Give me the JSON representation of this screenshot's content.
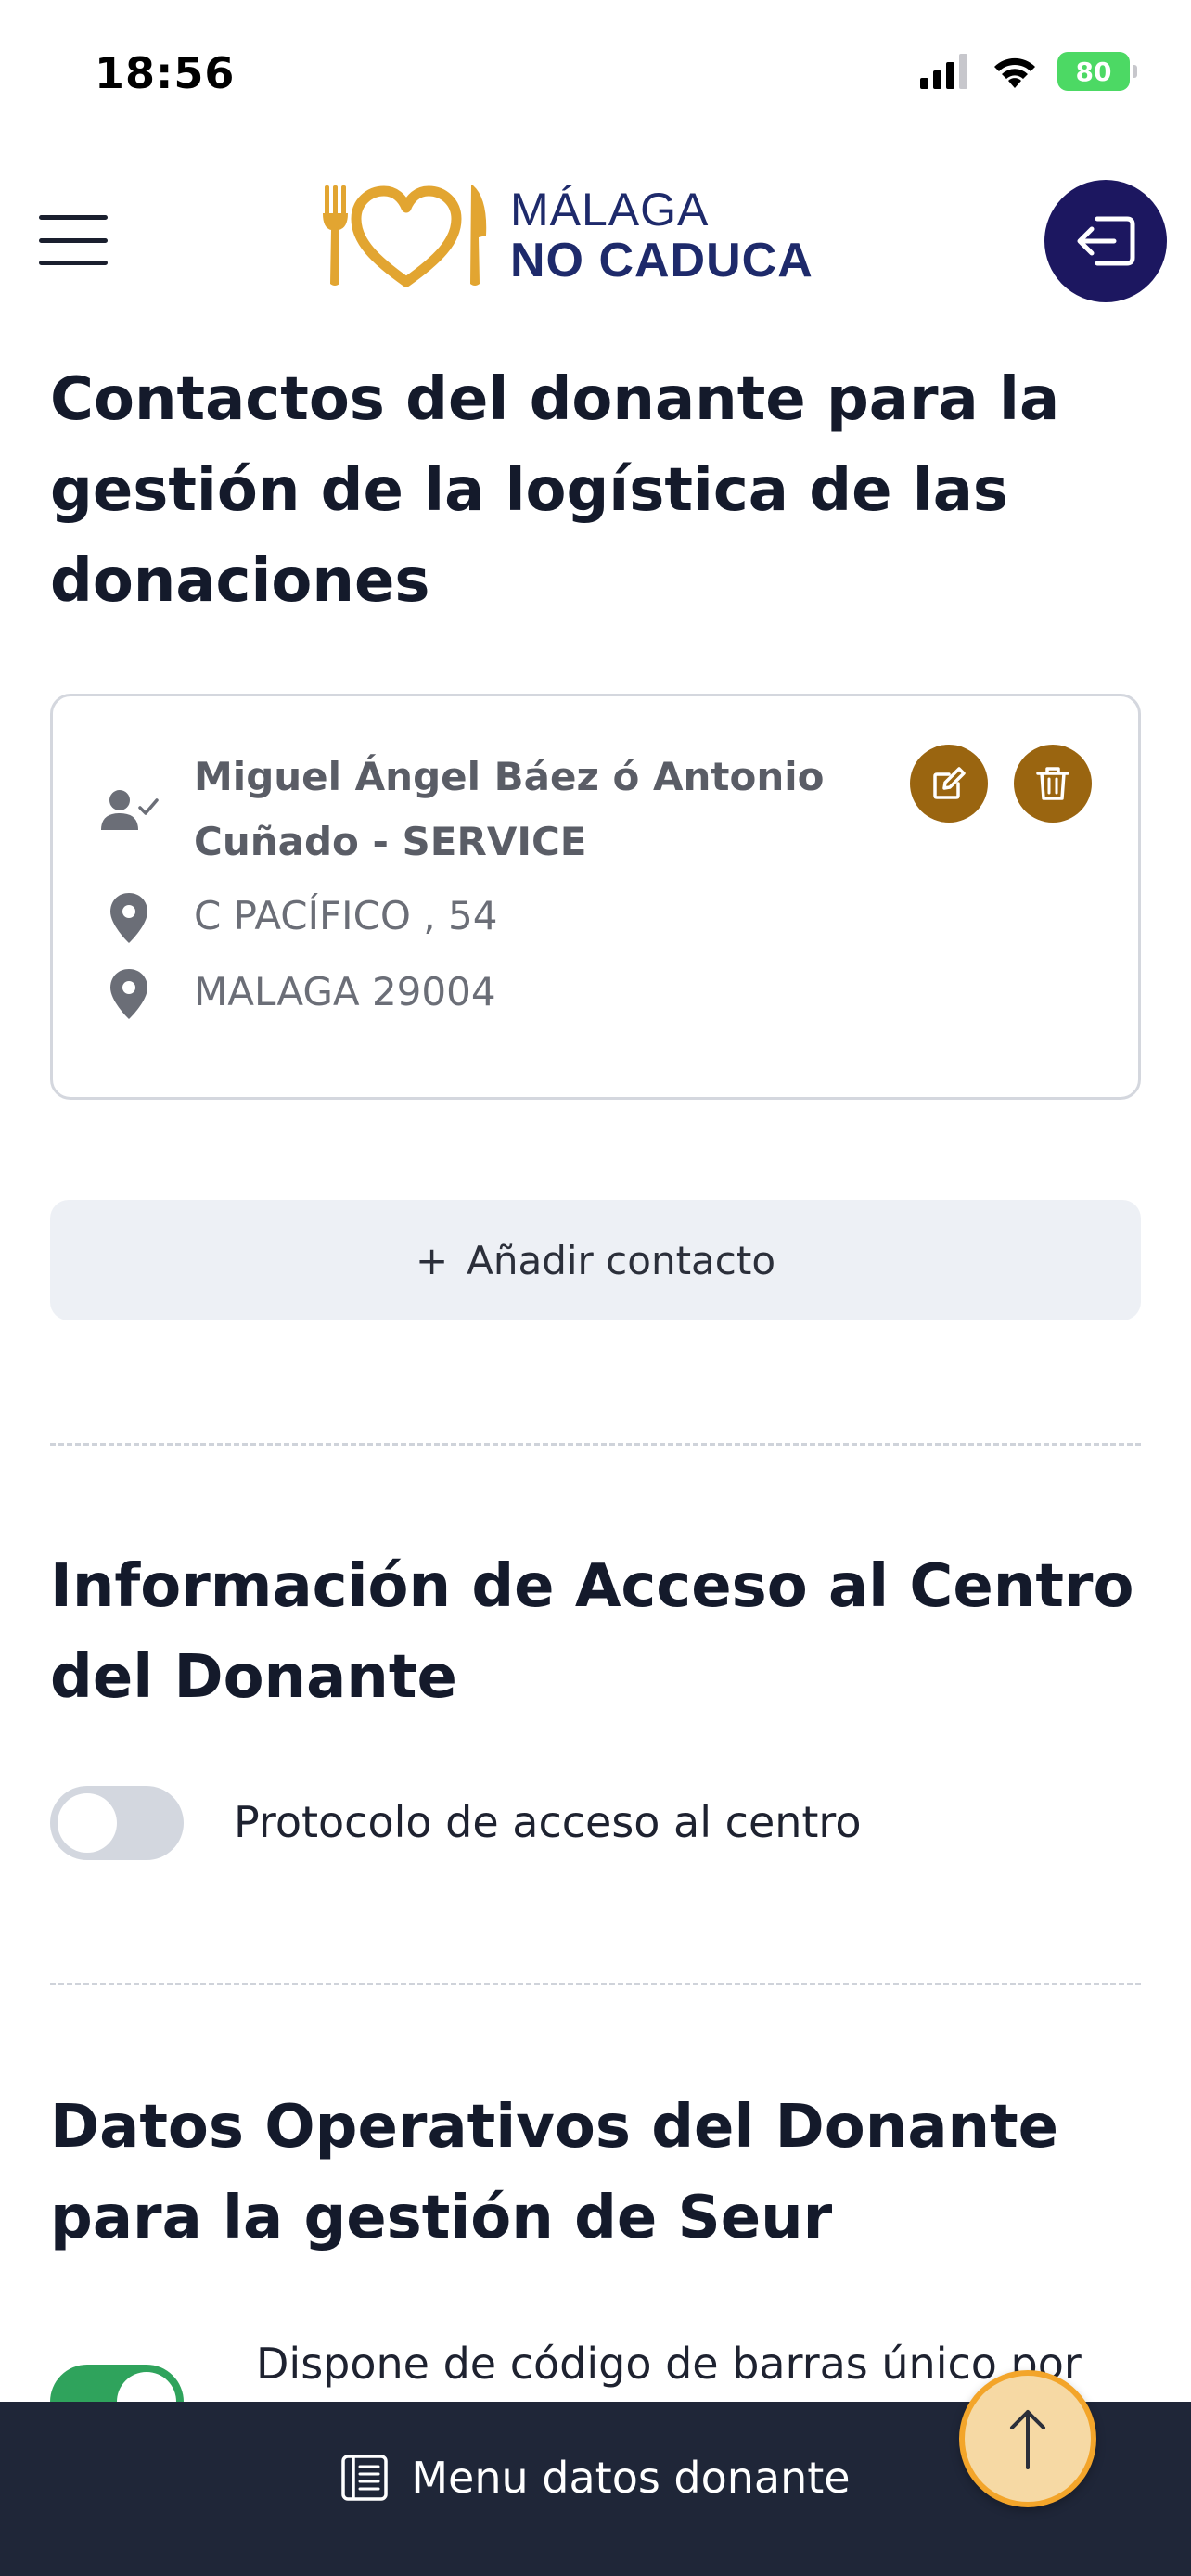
{
  "status_bar": {
    "time": "18:56",
    "battery": "80"
  },
  "header": {
    "logo_line1": "MÁLAGA",
    "logo_line2": "NO CADUCA",
    "logo_colors": {
      "gold": "#e2a531",
      "navy": "#1e2a6b"
    }
  },
  "sections": {
    "contacts_title": "Contactos del donante para la gestión de la logística de las donaciones",
    "access_title": "Información de Acceso al Centro del Donante",
    "operational_title": "Datos Operativos del Donante para la gestión de Seur"
  },
  "contact": {
    "name": "Miguel Ángel Báez ó Antonio Cuñado -  SERVICE",
    "address_line1": "C PACÍFICO , 54",
    "address_line2": "MALAGA 29004"
  },
  "add_contact": {
    "plus": "+",
    "label": "Añadir contacto"
  },
  "toggles": {
    "access_protocol": {
      "label": "Protocolo de acceso al centro",
      "on": false
    },
    "barcode": {
      "label": "Dispone de código de barras único por",
      "on": true
    }
  },
  "bottom_bar": {
    "label": "Menu datos donante"
  },
  "colors": {
    "action_brown": "#9a6510",
    "logout_navy": "#1c1760",
    "toggle_green": "#2fa35c",
    "bottom_bar": "#1f2638",
    "scroll_top_bg": "#f6d9a4",
    "scroll_top_ring": "#f3a52a"
  }
}
